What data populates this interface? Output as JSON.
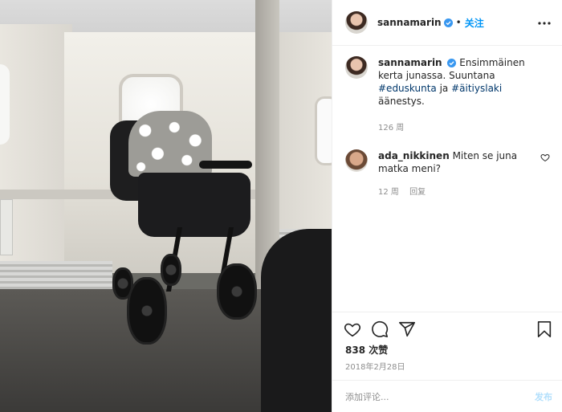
{
  "header": {
    "username": "sannamarin",
    "separator": "•",
    "follow_label": "关注"
  },
  "caption": {
    "username": "sannamarin",
    "text_before": "Ensimmäinen kerta junassa. Suuntana ",
    "hashtag1": "#eduskunta",
    "text_middle": " ja ",
    "hashtag2": "#äitiyslaki",
    "text_after": " äänestys.",
    "age": "126 周"
  },
  "comments": [
    {
      "username": "ada_nikkinen",
      "text": "Miten se juna matka meni?",
      "age": "12 周",
      "reply_label": "回复"
    }
  ],
  "actions": {
    "likes": "838 次赞",
    "date": "2018年2月28日",
    "comment_placeholder": "添加评论...",
    "post_label": "发布"
  },
  "colors": {
    "accent": "#0095f6",
    "hashtag": "#00376b",
    "muted": "#8e8e8e",
    "post_disabled": "#b2dffc"
  },
  "icons": [
    "verified-badge-icon",
    "more-options-icon",
    "heart-icon",
    "comment-icon",
    "share-icon",
    "bookmark-icon"
  ]
}
